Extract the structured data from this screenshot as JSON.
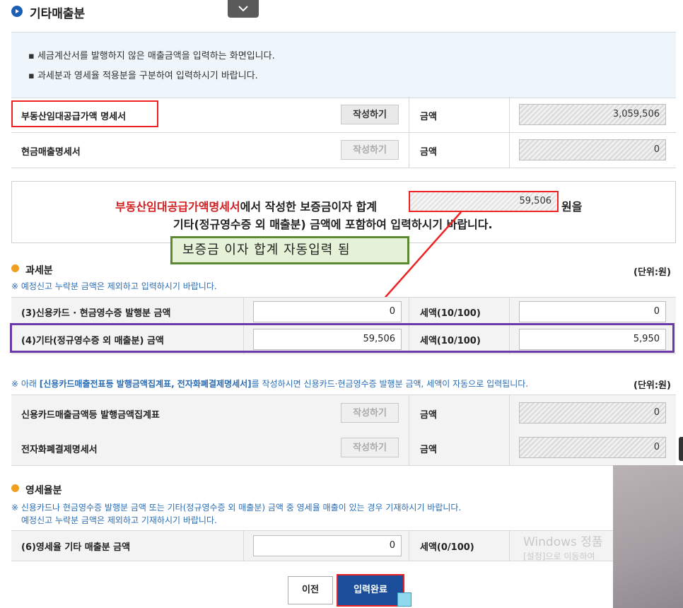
{
  "header": {
    "title": "기타매출분"
  },
  "info": {
    "lines": [
      "세금계산서를 발행하지 않은 매출금액을 입력하는 화면입니다.",
      "과세분과 영세율 적용분을 구분하여 입력하시기 바랍니다."
    ]
  },
  "top_rows": [
    {
      "label": "부동산임대공급가액 명세서",
      "button": "작성하기",
      "amount_label": "금액",
      "amount": "3,059,506"
    },
    {
      "label": "현금매출명세서",
      "button": "작성하기",
      "amount_label": "금액",
      "amount": "0"
    }
  ],
  "notice": {
    "red_part": "부동산임대공급가액명세서",
    "line1_rest": "에서 작성한 보증금이자 합계",
    "interest_total": "59,506",
    "won_suffix": "원을",
    "line2": "기타(정규영수증 외 매출분) 금액에 포함하여 입력하시기 바랍니다."
  },
  "callout": "보증금 이자 합계 자동입력 됨",
  "taxable": {
    "title": "과세분",
    "unit": "(단위:원)",
    "note": "※ 예정신고 누락분 금액은 제외하고 입력하시기 바랍니다.",
    "rows": [
      {
        "label": "(3)신용카드 · 현금영수증 발행분 금액",
        "value": "0",
        "tax_label": "세액(10/100)",
        "tax": "0"
      },
      {
        "label": "(4)기타(정규영수증 외 매출분) 금액",
        "value": "59,506",
        "tax_label": "세액(10/100)",
        "tax": "5,950"
      }
    ]
  },
  "card_note": {
    "prefix": "※ 아래 ",
    "bold": "[신용카드매출전표등 발행금액집계표, 전자화폐결제명세서]",
    "suffix": "를 작성하시면 신용카드·현금영수증 발행분 금액, 세액이 자동으로 입력됩니다.",
    "unit": "(단위:원)"
  },
  "card_rows": [
    {
      "label": "신용카드매출금액등 발행금액집계표",
      "button": "작성하기",
      "amount_label": "금액",
      "amount": "0"
    },
    {
      "label": "전자화폐결제명세서",
      "button": "작성하기",
      "amount_label": "금액",
      "amount": "0"
    }
  ],
  "zero_rate": {
    "title": "영세율분",
    "note1": "※ 신용카드나 현금영수증 발행분 금액 또는 기타(정규영수증 외 매출분) 금액 중 영세율 매출이 있는 경우 기재하시기 바랍니다.",
    "note2": "예정신고 누락분 금액은 제외하고 기재하시기 바랍니다.",
    "row": {
      "label": "(6)영세율 기타 매출분 금액",
      "value": "0",
      "tax_label": "세액(0/100)"
    }
  },
  "buttons": {
    "prev": "이전",
    "done": "입력완료"
  },
  "watermark": {
    "line1": "Windows 정품",
    "line2": "[설정]으로 이동하여"
  },
  "colors": {
    "accent_red": "#e22222",
    "primary_blue": "#1b4e9a",
    "note_blue": "#2a6db5",
    "highlight_purple": "#6b3aa8",
    "callout_green": "#5b8a32"
  }
}
